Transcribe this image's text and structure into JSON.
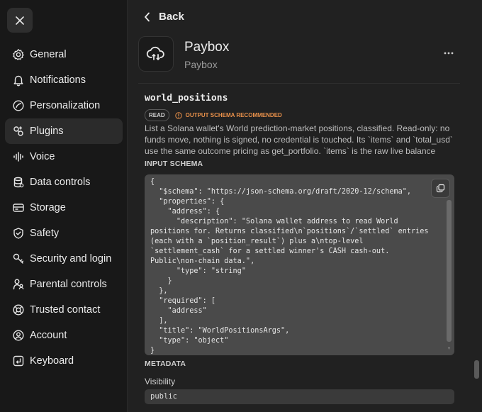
{
  "sidebar": {
    "close_icon": "close-icon",
    "items": [
      {
        "label": "General",
        "icon": "gear-icon",
        "active": false
      },
      {
        "label": "Notifications",
        "icon": "bell-icon",
        "active": false
      },
      {
        "label": "Personalization",
        "icon": "palette-icon",
        "active": false
      },
      {
        "label": "Plugins",
        "icon": "plugins-icon",
        "active": true
      },
      {
        "label": "Voice",
        "icon": "waveform-icon",
        "active": false
      },
      {
        "label": "Data controls",
        "icon": "database-icon",
        "active": false
      },
      {
        "label": "Storage",
        "icon": "storage-icon",
        "active": false
      },
      {
        "label": "Safety",
        "icon": "shield-icon",
        "active": false
      },
      {
        "label": "Security and login",
        "icon": "key-icon",
        "active": false
      },
      {
        "label": "Parental controls",
        "icon": "parent-icon",
        "active": false
      },
      {
        "label": "Trusted contact",
        "icon": "lifebuoy-icon",
        "active": false
      },
      {
        "label": "Account",
        "icon": "account-icon",
        "active": false
      },
      {
        "label": "Keyboard",
        "icon": "keyboard-icon",
        "active": false
      }
    ]
  },
  "main": {
    "back_label": "Back",
    "app": {
      "name": "Paybox",
      "subtitle": "Paybox"
    },
    "tool": {
      "name": "world_positions",
      "read_badge": "READ",
      "warning_badge": "OUTPUT SCHEMA RECOMMENDED",
      "description": "List a Solana wallet's World prediction-market positions, classified. Read-only: no funds move, nothing is signed, no credential is touched. Its `items` and `total_usd` use the same outcome pricing as get_portfolio. `items` is the raw live balance fee..."
    },
    "input_schema_label": "INPUT SCHEMA",
    "input_schema": "{\n  \"$schema\": \"https://json-schema.org/draft/2020-12/schema\",\n  \"properties\": {\n    \"address\": {\n      \"description\": \"Solana wallet address to read World positions for. Returns classified\\n`positions`/`settled` entries (each with a `position_result`) plus a\\ntop-level `settlement_cash` for a settled winner's CASH cash-out. Public\\non-chain data.\",\n      \"type\": \"string\"\n    }\n  },\n  \"required\": [\n    \"address\"\n  ],\n  \"title\": \"WorldPositionsArgs\",\n  \"type\": \"object\"\n}",
    "metadata_label": "METADATA",
    "visibility_label": "Visibility",
    "visibility_value": "public"
  },
  "colors": {
    "warning": "#e8904a",
    "background": "#212121",
    "sidebar": "#181818"
  }
}
